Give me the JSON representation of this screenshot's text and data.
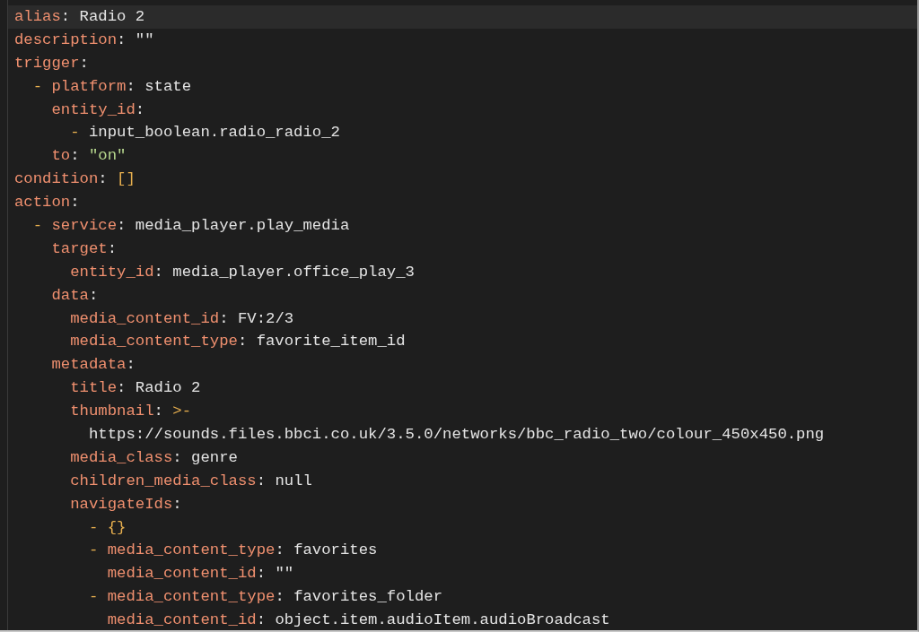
{
  "editor": {
    "lines": [
      {
        "active": true,
        "parts": [
          {
            "text": "alias",
            "kind": "key"
          },
          {
            "text": ": Radio 2",
            "kind": "plain"
          }
        ]
      },
      {
        "active": false,
        "parts": [
          {
            "text": "description",
            "kind": "key"
          },
          {
            "text": ": \"\"",
            "kind": "plain"
          }
        ]
      },
      {
        "active": false,
        "parts": [
          {
            "text": "trigger",
            "kind": "key"
          },
          {
            "text": ":",
            "kind": "plain"
          }
        ]
      },
      {
        "active": false,
        "parts": [
          {
            "text": "  -",
            "kind": "punct"
          },
          {
            "text": " platform",
            "kind": "key"
          },
          {
            "text": ": state",
            "kind": "plain"
          }
        ]
      },
      {
        "active": false,
        "parts": [
          {
            "text": "    entity_id",
            "kind": "key"
          },
          {
            "text": ":",
            "kind": "plain"
          }
        ]
      },
      {
        "active": false,
        "parts": [
          {
            "text": "      -",
            "kind": "punct"
          },
          {
            "text": " input_boolean.radio_radio_2",
            "kind": "plain"
          }
        ]
      },
      {
        "active": false,
        "parts": [
          {
            "text": "    to",
            "kind": "key"
          },
          {
            "text": ": ",
            "kind": "plain"
          },
          {
            "text": "\"on\"",
            "kind": "string"
          }
        ]
      },
      {
        "active": false,
        "parts": [
          {
            "text": "condition",
            "kind": "key"
          },
          {
            "text": ": ",
            "kind": "plain"
          },
          {
            "text": "[]",
            "kind": "punct"
          }
        ]
      },
      {
        "active": false,
        "parts": [
          {
            "text": "action",
            "kind": "key"
          },
          {
            "text": ":",
            "kind": "plain"
          }
        ]
      },
      {
        "active": false,
        "parts": [
          {
            "text": "  -",
            "kind": "punct"
          },
          {
            "text": " service",
            "kind": "key"
          },
          {
            "text": ": media_player.play_media",
            "kind": "plain"
          }
        ]
      },
      {
        "active": false,
        "parts": [
          {
            "text": "    target",
            "kind": "key"
          },
          {
            "text": ":",
            "kind": "plain"
          }
        ]
      },
      {
        "active": false,
        "parts": [
          {
            "text": "      entity_id",
            "kind": "key"
          },
          {
            "text": ": media_player.office_play_3",
            "kind": "plain"
          }
        ]
      },
      {
        "active": false,
        "parts": [
          {
            "text": "    data",
            "kind": "key"
          },
          {
            "text": ":",
            "kind": "plain"
          }
        ]
      },
      {
        "active": false,
        "parts": [
          {
            "text": "      media_content_id",
            "kind": "key"
          },
          {
            "text": ": FV:2/3",
            "kind": "plain"
          }
        ]
      },
      {
        "active": false,
        "parts": [
          {
            "text": "      media_content_type",
            "kind": "key"
          },
          {
            "text": ": favorite_item_id",
            "kind": "plain"
          }
        ]
      },
      {
        "active": false,
        "parts": [
          {
            "text": "    metadata",
            "kind": "key"
          },
          {
            "text": ":",
            "kind": "plain"
          }
        ]
      },
      {
        "active": false,
        "parts": [
          {
            "text": "      title",
            "kind": "key"
          },
          {
            "text": ": Radio 2",
            "kind": "plain"
          }
        ]
      },
      {
        "active": false,
        "parts": [
          {
            "text": "      thumbnail",
            "kind": "key"
          },
          {
            "text": ": ",
            "kind": "plain"
          },
          {
            "text": ">-",
            "kind": "punct"
          }
        ]
      },
      {
        "active": false,
        "parts": [
          {
            "text": "        https://sounds.files.bbci.co.uk/3.5.0/networks/bbc_radio_two/colour_450x450.png",
            "kind": "plain"
          }
        ]
      },
      {
        "active": false,
        "parts": [
          {
            "text": "      media_class",
            "kind": "key"
          },
          {
            "text": ": genre",
            "kind": "plain"
          }
        ]
      },
      {
        "active": false,
        "parts": [
          {
            "text": "      children_media_class",
            "kind": "key"
          },
          {
            "text": ": null",
            "kind": "plain"
          }
        ]
      },
      {
        "active": false,
        "parts": [
          {
            "text": "      navigateIds",
            "kind": "key"
          },
          {
            "text": ":",
            "kind": "plain"
          }
        ]
      },
      {
        "active": false,
        "parts": [
          {
            "text": "        - {}",
            "kind": "punct"
          }
        ]
      },
      {
        "active": false,
        "parts": [
          {
            "text": "        -",
            "kind": "punct"
          },
          {
            "text": " media_content_type",
            "kind": "key"
          },
          {
            "text": ": favorites",
            "kind": "plain"
          }
        ]
      },
      {
        "active": false,
        "parts": [
          {
            "text": "          media_content_id",
            "kind": "key"
          },
          {
            "text": ": \"\"",
            "kind": "plain"
          }
        ]
      },
      {
        "active": false,
        "parts": [
          {
            "text": "        -",
            "kind": "punct"
          },
          {
            "text": " media_content_type",
            "kind": "key"
          },
          {
            "text": ": favorites_folder",
            "kind": "plain"
          }
        ]
      },
      {
        "active": false,
        "parts": [
          {
            "text": "          media_content_id",
            "kind": "key"
          },
          {
            "text": ": object.item.audioItem.audioBroadcast",
            "kind": "plain"
          }
        ]
      }
    ]
  }
}
